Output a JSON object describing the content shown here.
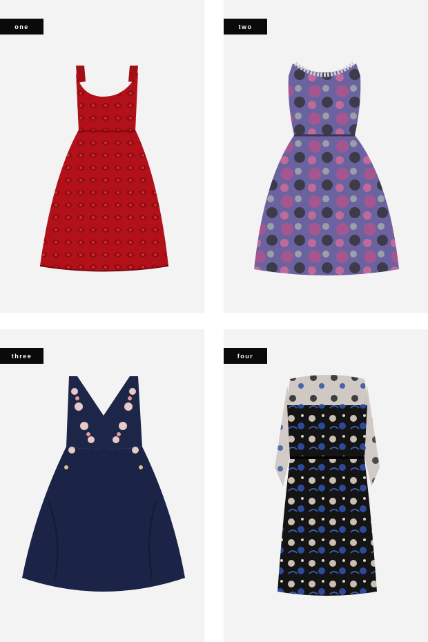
{
  "panels": [
    {
      "label": "one",
      "dress": "red lace fit-and-flare dress"
    },
    {
      "label": "two",
      "dress": "purple floral jacquard dress with jeweled neckline"
    },
    {
      "label": "three",
      "dress": "navy v-neck dress with floral appliqué"
    },
    {
      "label": "four",
      "dress": "black sheer floral embroidered long-sleeve dress"
    }
  ],
  "colors": {
    "panel_bg": "#f4f3f4",
    "tag_bg": "#0a0a0a",
    "red": "#b5121b",
    "purple": "#6a5a8e",
    "navy": "#1c2447",
    "black": "#151515"
  }
}
